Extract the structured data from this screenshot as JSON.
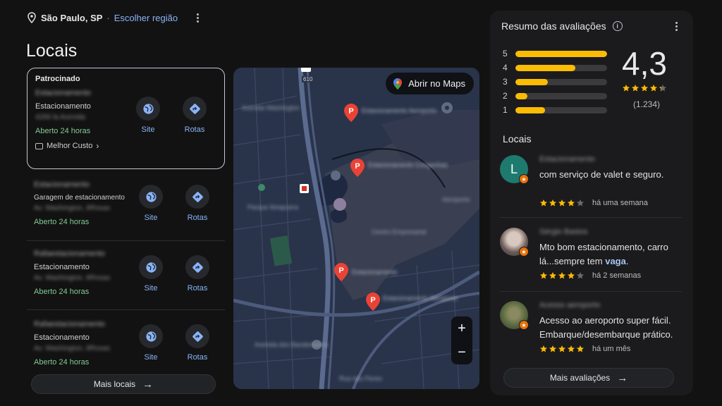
{
  "region": {
    "city": "São Paulo, SP",
    "separator": "·",
    "change_link": "Escolher região"
  },
  "page_title": "Locais",
  "listings": [
    {
      "sponsored_label": "Patrocinado",
      "name": "Estacionamento",
      "category": "Estacionamento",
      "address": "4266 la Avenida",
      "hours": "Aberto 24 horas",
      "promo": "Melhor Custo",
      "site_label": "Site",
      "routes_label": "Rotas"
    },
    {
      "name": "Estacionamento",
      "category": "Garagem de estacionamento",
      "address": "Av. Washington, 8Rosas",
      "hours": "Aberto 24 horas",
      "site_label": "Site",
      "routes_label": "Rotas"
    },
    {
      "name": "Rafaestacionamento",
      "category": "Estacionamento",
      "address": "Av. Washington, 8Rosas",
      "hours": "Aberto 24 horas",
      "site_label": "Site",
      "routes_label": "Rotas"
    },
    {
      "name": "Rafaestacionamento",
      "category": "Estacionamento",
      "address": "Av. Washington, 8Rosas",
      "hours": "Aberto 24 horas",
      "site_label": "Site",
      "routes_label": "Rotas"
    }
  ],
  "more_places_label": "Mais locais",
  "map": {
    "open_maps_label": "Abrir no Maps",
    "road_shield": "610",
    "zoom_in": "+",
    "zoom_out": "−",
    "pins": [
      {
        "label": "Estacionamento Aeroporto"
      },
      {
        "label": "Estacionamento Congonhas"
      },
      {
        "label": "Estacionamento"
      },
      {
        "label": "Estacionamento Aeroporto"
      }
    ],
    "street_labels": [
      "Avenida Washington",
      "Parque Ibirapuera",
      "Centro Empresarial",
      "Aeroporto",
      "Avenida dos Bandeirantes",
      "Rua das Flores"
    ]
  },
  "reviews": {
    "title": "Resumo das avaliações",
    "rating": "4,3",
    "rating_value": 4.3,
    "count": "(1.234)",
    "distribution": [
      {
        "stars": "5",
        "fraction": 1.0
      },
      {
        "stars": "4",
        "fraction": 0.65
      },
      {
        "stars": "3",
        "fraction": 0.35
      },
      {
        "stars": "2",
        "fraction": 0.13
      },
      {
        "stars": "1",
        "fraction": 0.32
      }
    ],
    "places_title": "Locais",
    "items": [
      {
        "name": "Estacionamento",
        "avatar_letter": "L",
        "text_1": "com serviço de valet e seguro.",
        "stars": 4,
        "when": "há uma semana"
      },
      {
        "name": "Sérgio Bastos",
        "text_1": "Mto bom estacionamento, carro lá...sempre tem",
        "highlight": "vaga",
        "text_2": ".",
        "stars": 4,
        "when": "há 2 semanas"
      },
      {
        "name": "Acesso aeroporto",
        "text_1": "Acesso ao aeroporto super fácil. Embarque/desembarque prático.",
        "stars": 5,
        "when": "há um mês"
      }
    ],
    "more_label": "Mais avaliações"
  },
  "colors": {
    "accent_blue": "#8ab4f8",
    "open_green": "#81c995",
    "star_yellow": "#fbbc04",
    "pin_red": "#ea4335"
  }
}
